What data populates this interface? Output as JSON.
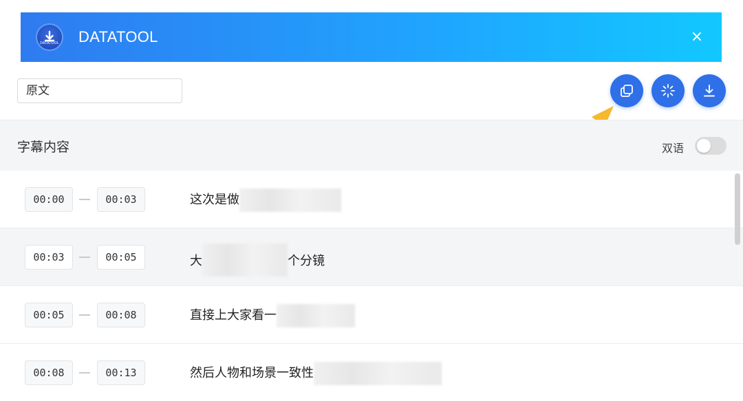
{
  "app": {
    "title": "DATATOOL",
    "logo_text": "DATATOOL",
    "close_glyph": "×"
  },
  "toolbar": {
    "language_value": "原文",
    "buttons": [
      {
        "icon": "copy-icon"
      },
      {
        "icon": "magic-wand-icon"
      },
      {
        "icon": "download-icon"
      }
    ]
  },
  "section": {
    "title": "字幕内容",
    "bilingual_label": "双语",
    "bilingual_enabled": false
  },
  "subtitles": [
    {
      "start": "00:00",
      "end": "00:03",
      "text_visible": "这次是做",
      "text_tail": ""
    },
    {
      "start": "00:03",
      "end": "00:05",
      "text_visible": "大",
      "text_tail": "个分镜"
    },
    {
      "start": "00:05",
      "end": "00:08",
      "text_visible": "直接上大家看一",
      "text_tail": ""
    },
    {
      "start": "00:08",
      "end": "00:13",
      "text_visible": "然后人物和场景一致性",
      "text_tail": ""
    }
  ],
  "colors": {
    "accent": "#2f6fe8",
    "header_gradient_start": "#2f7bf0",
    "header_gradient_end": "#12c8ff",
    "annotation_arrow": "#f5b82e"
  }
}
